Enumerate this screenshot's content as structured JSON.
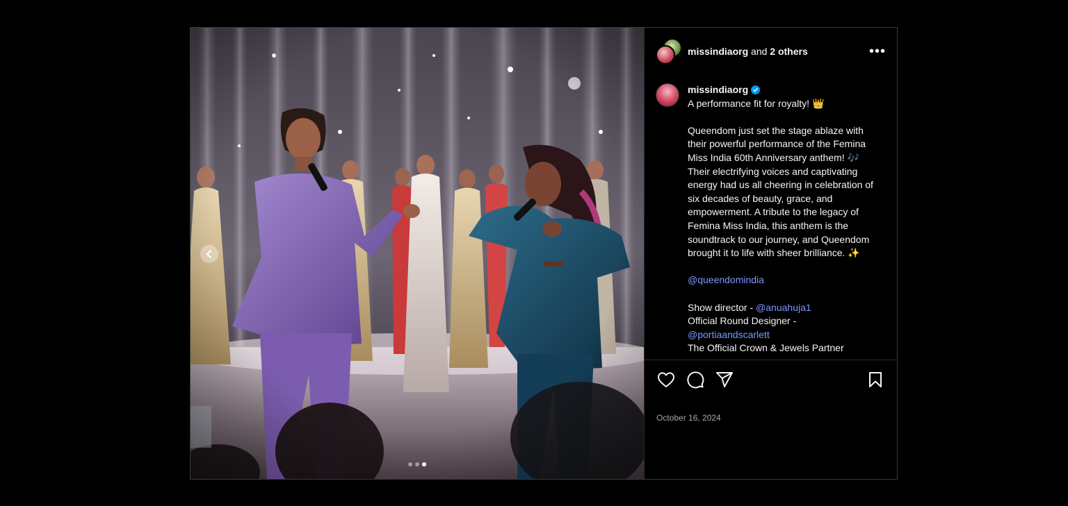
{
  "header": {
    "username": "missindiaorg",
    "and_text": "and",
    "others_text": "2 others",
    "more_label": "•••"
  },
  "caption": {
    "username": "missindiaorg",
    "headline": "A performance fit for royalty! 👑",
    "body": "Queendom just set the stage ablaze with their powerful performance of the Femina Miss India 60th Anniversary anthem! 🎶 Their electrifying voices and captivating energy had us all cheering in celebration of six decades of beauty, grace, and empowerment. A tribute to the legacy of Femina Miss India, this anthem is the soundtrack to our journey, and Queendom brought it to life with sheer brilliance. ✨",
    "mention_queendom": "@queendomindia",
    "show_director_label": "Show director - ",
    "show_director_handle": "@anuahuja1",
    "designer_label": "Official Round Designer -",
    "designer_handle": "@portiaandscarlett",
    "cutoff_line": "The Official Crown & Jewels Partner"
  },
  "carousel": {
    "total": 3,
    "active_index": 2
  },
  "footer": {
    "date": "October 16, 2024"
  },
  "colors": {
    "link": "#7a98ff",
    "verified": "#0095f6",
    "background": "#000000"
  },
  "icons": [
    "heart-icon",
    "comment-icon",
    "share-icon",
    "bookmark-icon",
    "more-icon",
    "verified-badge-icon",
    "chevron-left-icon"
  ]
}
